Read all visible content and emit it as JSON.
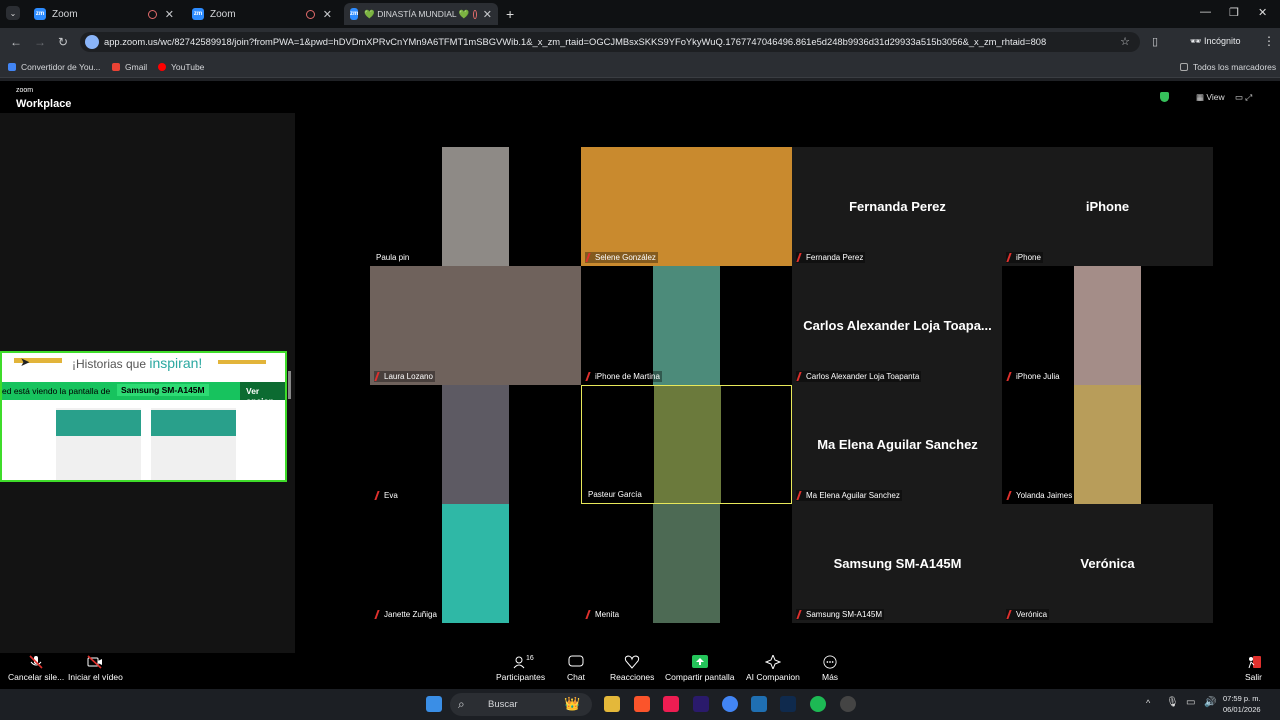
{
  "browser": {
    "tabs": [
      {
        "label": "Zoom"
      },
      {
        "label": "Zoom"
      },
      {
        "label": "💚 DINASTÍA MUNDIAL 💚"
      }
    ],
    "url": "app.zoom.us/wc/82742589918/join?fromPWA=1&pwd=hDVDmXPRvCnYMn9A6TFMT1mSBGVWib.1&_x_zm_rtaid=OGCJMBsxSKKS9YFoYkyWuQ.1767747046496.861e5d248b9936d31d29933a515b3056&_x_zm_rhtaid=808",
    "incognito_label": "Incógnito",
    "bookmarks": [
      {
        "label": "Convertidor de You..."
      },
      {
        "label": "Gmail"
      },
      {
        "label": "YouTube"
      }
    ],
    "all_bookmarks": "Todos los marcadores"
  },
  "zoom": {
    "logo_small": "zoom",
    "logo": "Workplace",
    "view_label": "View",
    "share": {
      "banner_title_prefix": "¡Historias que ",
      "banner_title_emph": "inspiran!",
      "viewing_text": "ed está viendo la pantalla de",
      "device": "Samsung SM-A145M",
      "options": "Ver opcion"
    },
    "participants": [
      {
        "label": "Paula pin",
        "name_display": ""
      },
      {
        "label": "Selene González",
        "name_display": ""
      },
      {
        "label": "Fernanda Perez",
        "name_display": "Fernanda Perez"
      },
      {
        "label": "iPhone",
        "name_display": "iPhone"
      },
      {
        "label": "Laura Lozano",
        "name_display": ""
      },
      {
        "label": "iPhone de Martina",
        "name_display": ""
      },
      {
        "label": "Carlos Alexander Loja Toapanta",
        "name_display": "Carlos Alexander Loja Toapa..."
      },
      {
        "label": "iPhone Julia",
        "name_display": ""
      },
      {
        "label": "Eva",
        "name_display": ""
      },
      {
        "label": "Pasteur García",
        "name_display": ""
      },
      {
        "label": "Ma Elena Aguilar Sanchez",
        "name_display": "Ma Elena Aguilar Sanchez"
      },
      {
        "label": "Yolanda Jaimes",
        "name_display": ""
      },
      {
        "label": "Janette Zuñiga",
        "name_display": ""
      },
      {
        "label": "Menita",
        "name_display": ""
      },
      {
        "label": "Samsung SM-A145M",
        "name_display": "Samsung SM-A145M"
      },
      {
        "label": "Verónica",
        "name_display": "Verónica"
      }
    ],
    "controls": {
      "mute": "Cancelar sile...",
      "video": "Iniciar el vídeo",
      "participants": "Participantes",
      "participants_count": "16",
      "chat": "Chat",
      "reactions": "Reacciones",
      "share": "Compartir pantalla",
      "ai": "AI Companion",
      "more": "Más",
      "leave": "Salir"
    }
  },
  "taskbar": {
    "search": "Buscar",
    "time": "07:59 p. m.",
    "date": "06/01/2026"
  },
  "colors": {
    "accent_green": "#3fdc2a",
    "share_green": "#17c35e",
    "mute_red": "#e0302d",
    "active_speaker": "#e8e85a"
  }
}
